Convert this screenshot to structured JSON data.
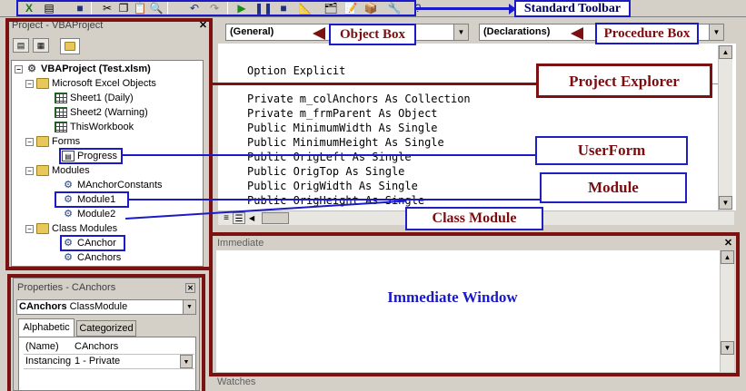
{
  "toolbar": {
    "label": "Standard Toolbar",
    "icons": [
      "excel-icon",
      "insert-userform-icon",
      "save-icon",
      "cut-icon",
      "copy-icon",
      "paste-icon",
      "find-icon",
      "undo-icon",
      "redo-icon",
      "run-icon",
      "break-icon",
      "reset-icon",
      "design-mode-icon",
      "project-explorer-icon",
      "properties-icon",
      "object-browser-icon",
      "toolbox-icon",
      "help-icon"
    ]
  },
  "project": {
    "title": "Project - VBAProject",
    "root": "VBAProject (Test.xlsm)",
    "folders": {
      "excel_objects": "Microsoft Excel Objects",
      "forms": "Forms",
      "modules": "Modules",
      "class_modules": "Class Modules"
    },
    "items": {
      "sheet1": "Sheet1 (Daily)",
      "sheet2": "Sheet2 (Warning)",
      "thisworkbook": "ThisWorkbook",
      "progress": "Progress",
      "manchor": "MAnchorConstants",
      "module1": "Module1",
      "module2": "Module2",
      "canchor": "CAnchor",
      "canchors": "CAnchors"
    }
  },
  "properties": {
    "title": "Properties - CAnchors",
    "object_name": "CAnchors",
    "object_type": "ClassModule",
    "tabs": [
      "Alphabetic",
      "Categorized"
    ],
    "rows": [
      {
        "name": "(Name)",
        "value": "CAnchors"
      },
      {
        "name": "Instancing",
        "value": "1 - Private"
      }
    ]
  },
  "code": {
    "object_box": "(General)",
    "procedure_box": "(Declarations)",
    "lines": [
      "Option Explicit",
      "Private m_colAnchors As Collection",
      "Private m_frmParent As Object",
      "Public MinimumWidth As Single",
      "Public MinimumHeight As Single",
      "Public OrigLeft As Single",
      "Public OrigTop As Single",
      "Public OrigWidth As Single",
      "Public OrigHeight As Single"
    ]
  },
  "immediate": {
    "title": "Immediate"
  },
  "watches": {
    "title": "Watches"
  },
  "annotations": {
    "standard_toolbar": "Standard Toolbar",
    "object_box": "Object Box",
    "procedure_box": "Procedure Box",
    "project_explorer": "Project Explorer",
    "userform": "UserForm",
    "module": "Module",
    "class_module": "Class Module",
    "immediate_window": "Immediate Window"
  },
  "colors": {
    "annotation_text": "#7b0c10",
    "highlight_blue": "#1a1ac8",
    "highlight_red": "#7b1111",
    "immediate_text": "#1a1ac8"
  }
}
